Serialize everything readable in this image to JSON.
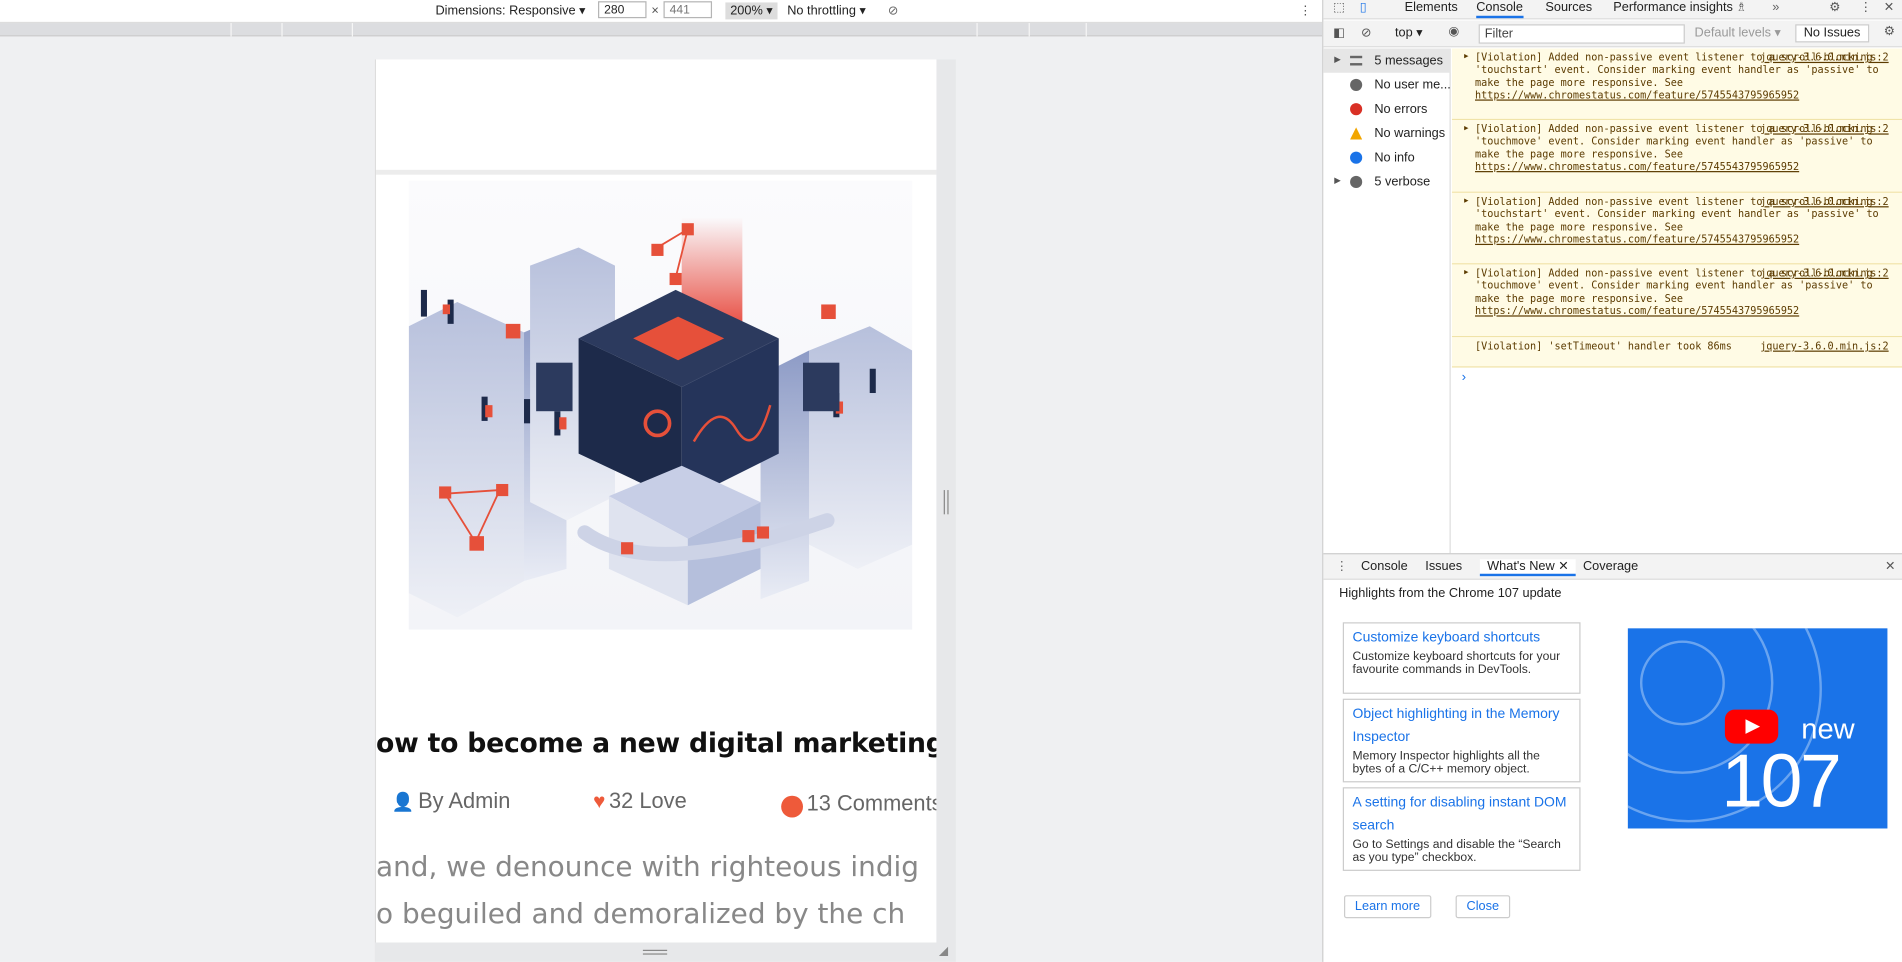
{
  "device_toolbar": {
    "dimensions_label": "Dimensions: Responsive ▾",
    "width_value": "280",
    "height_placeholder": "441",
    "zoom_label": "200% ▾",
    "throttling_label": "No throttling ▾"
  },
  "page": {
    "post_title": "ow to become a new digital marketing ic",
    "author": "By Admin",
    "loves": "32 Love",
    "comments": "13 Comments",
    "body_line1": "and, we denounce with righteous indig",
    "body_line2": "o beguiled and demoralized by the ch"
  },
  "devtools": {
    "tabs": [
      "Elements",
      "Console",
      "Sources",
      "Performance insights"
    ],
    "more_tabs": "»",
    "context": "top ▾",
    "filter_placeholder": "Filter",
    "levels": "Default levels ▾",
    "issues": "No Issues",
    "sidebar": [
      {
        "label": "5 messages",
        "icon": "list-icon"
      },
      {
        "label": "No user me...",
        "icon": "user-icon"
      },
      {
        "label": "No errors",
        "icon": "error-icon"
      },
      {
        "label": "No warnings",
        "icon": "warning-icon"
      },
      {
        "label": "No info",
        "icon": "info-icon"
      },
      {
        "label": "5 verbose",
        "icon": "bug-icon"
      }
    ],
    "messages": [
      {
        "text": "[Violation] Added non-passive event listener to a scroll-blocking 'touchstart' event. Consider marking event handler as 'passive' to make the page more responsive. See ",
        "link": "https://www.chromestatus.com/feature/5745543795965952",
        "src": "jquery-3.6.0.min.js:2"
      },
      {
        "text": "[Violation] Added non-passive event listener to a scroll-blocking 'touchmove' event. Consider marking event handler as 'passive' to make the page more responsive. See ",
        "link": "https://www.chromestatus.com/feature/5745543795965952",
        "src": "jquery-3.6.0.min.js:2"
      },
      {
        "text": "[Violation] Added non-passive event listener to a scroll-blocking 'touchstart' event. Consider marking event handler as 'passive' to make the page more responsive. See ",
        "link": "https://www.chromestatus.com/feature/5745543795965952",
        "src": "jquery-3.6.0.min.js:2"
      },
      {
        "text": "[Violation] Added non-passive event listener to a scroll-blocking 'touchmove' event. Consider marking event handler as 'passive' to make the page more responsive. See ",
        "link": "https://www.chromestatus.com/feature/5745543795965952",
        "src": "jquery-3.6.0.min.js:2"
      },
      {
        "text": "[Violation] 'setTimeout' handler took 86ms",
        "link": "",
        "src": "jquery-3.6.0.min.js:2"
      }
    ],
    "drawer_tabs": [
      "Console",
      "Issues",
      "What's New",
      "Coverage"
    ],
    "whats_new_header": "Highlights from the Chrome 107 update",
    "cards": [
      {
        "title": "Customize keyboard shortcuts",
        "desc": "Customize keyboard shortcuts for your favourite commands in DevTools."
      },
      {
        "title": "Object highlighting in the Memory Inspector",
        "desc": "Memory Inspector highlights all the bytes of a C/C++ memory object."
      },
      {
        "title": "A setting for disabling instant DOM search",
        "desc": "Go to Settings and disable the “Search as you type” checkbox."
      }
    ],
    "video_new": "new",
    "video_num": "107",
    "learn_more": "Learn more",
    "close": "Close"
  }
}
